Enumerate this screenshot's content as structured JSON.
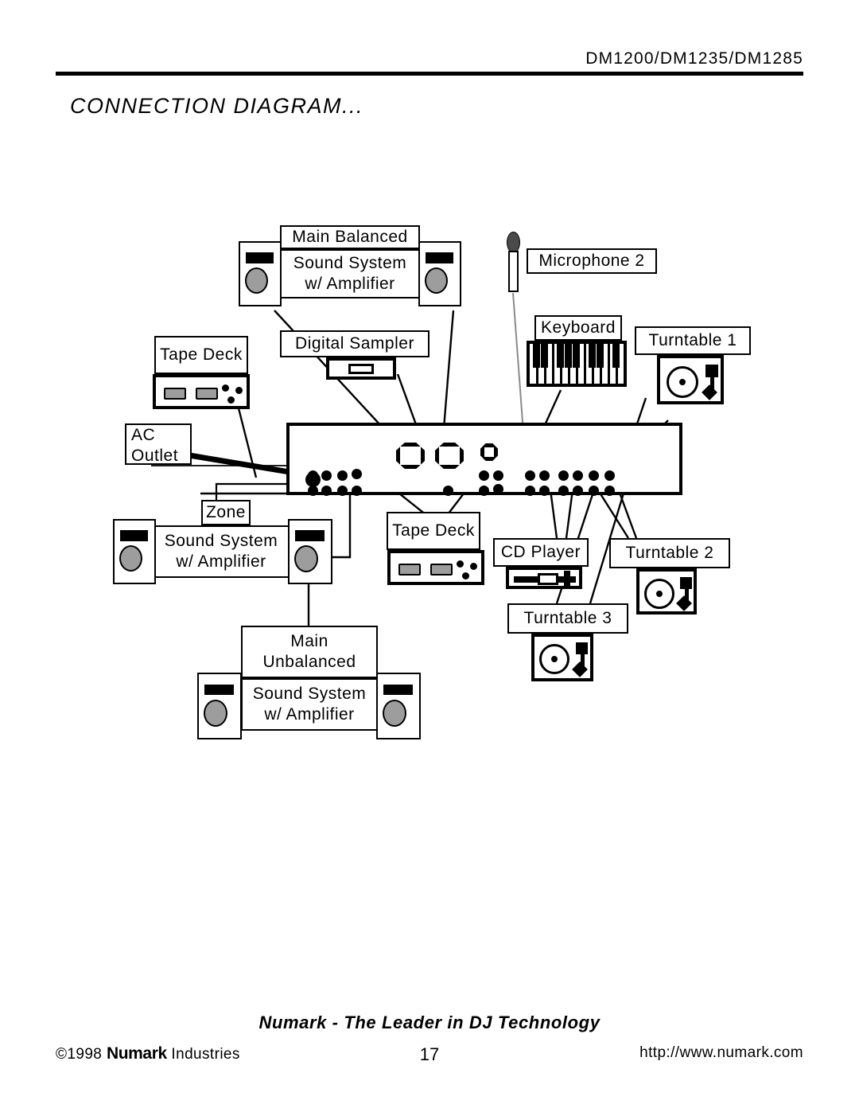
{
  "header": {
    "model": "DM1200/DM1235/DM1285",
    "title": "CONNECTION DIAGRAM..."
  },
  "footer": {
    "tagline": "Numark - The Leader in DJ Technology",
    "copyright_prefix": "©1998 ",
    "brand": "Numark",
    "copyright_suffix": " Industries",
    "page_number": "17",
    "url": "http://www.numark.com"
  },
  "diagram": {
    "main_balanced": {
      "title": "Main Balanced",
      "line1": "Sound System",
      "line2": "w/ Amplifier"
    },
    "main_unbalanced": {
      "title_line1": "Main",
      "title_line2": "Unbalanced",
      "line1": "Sound System",
      "line2": "w/ Amplifier"
    },
    "zone": {
      "title": "Zone",
      "line1": "Sound System",
      "line2": "w/ Amplifier"
    },
    "tape_deck_1": "Tape Deck",
    "tape_deck_2": "Tape Deck",
    "digital_sampler": "Digital Sampler",
    "ac_outlet_line1": "AC",
    "ac_outlet_line2": "Outlet",
    "microphone": "Microphone 2",
    "keyboard": "Keyboard",
    "turntable_1": "Turntable 1",
    "turntable_2": "Turntable 2",
    "turntable_3": "Turntable 3",
    "cd_player": "CD Player"
  },
  "colors": {
    "ink": "#000000",
    "speaker_cone": "#9d9d9d",
    "mic_head": "#4a4a4a",
    "paper": "#ffffff"
  }
}
